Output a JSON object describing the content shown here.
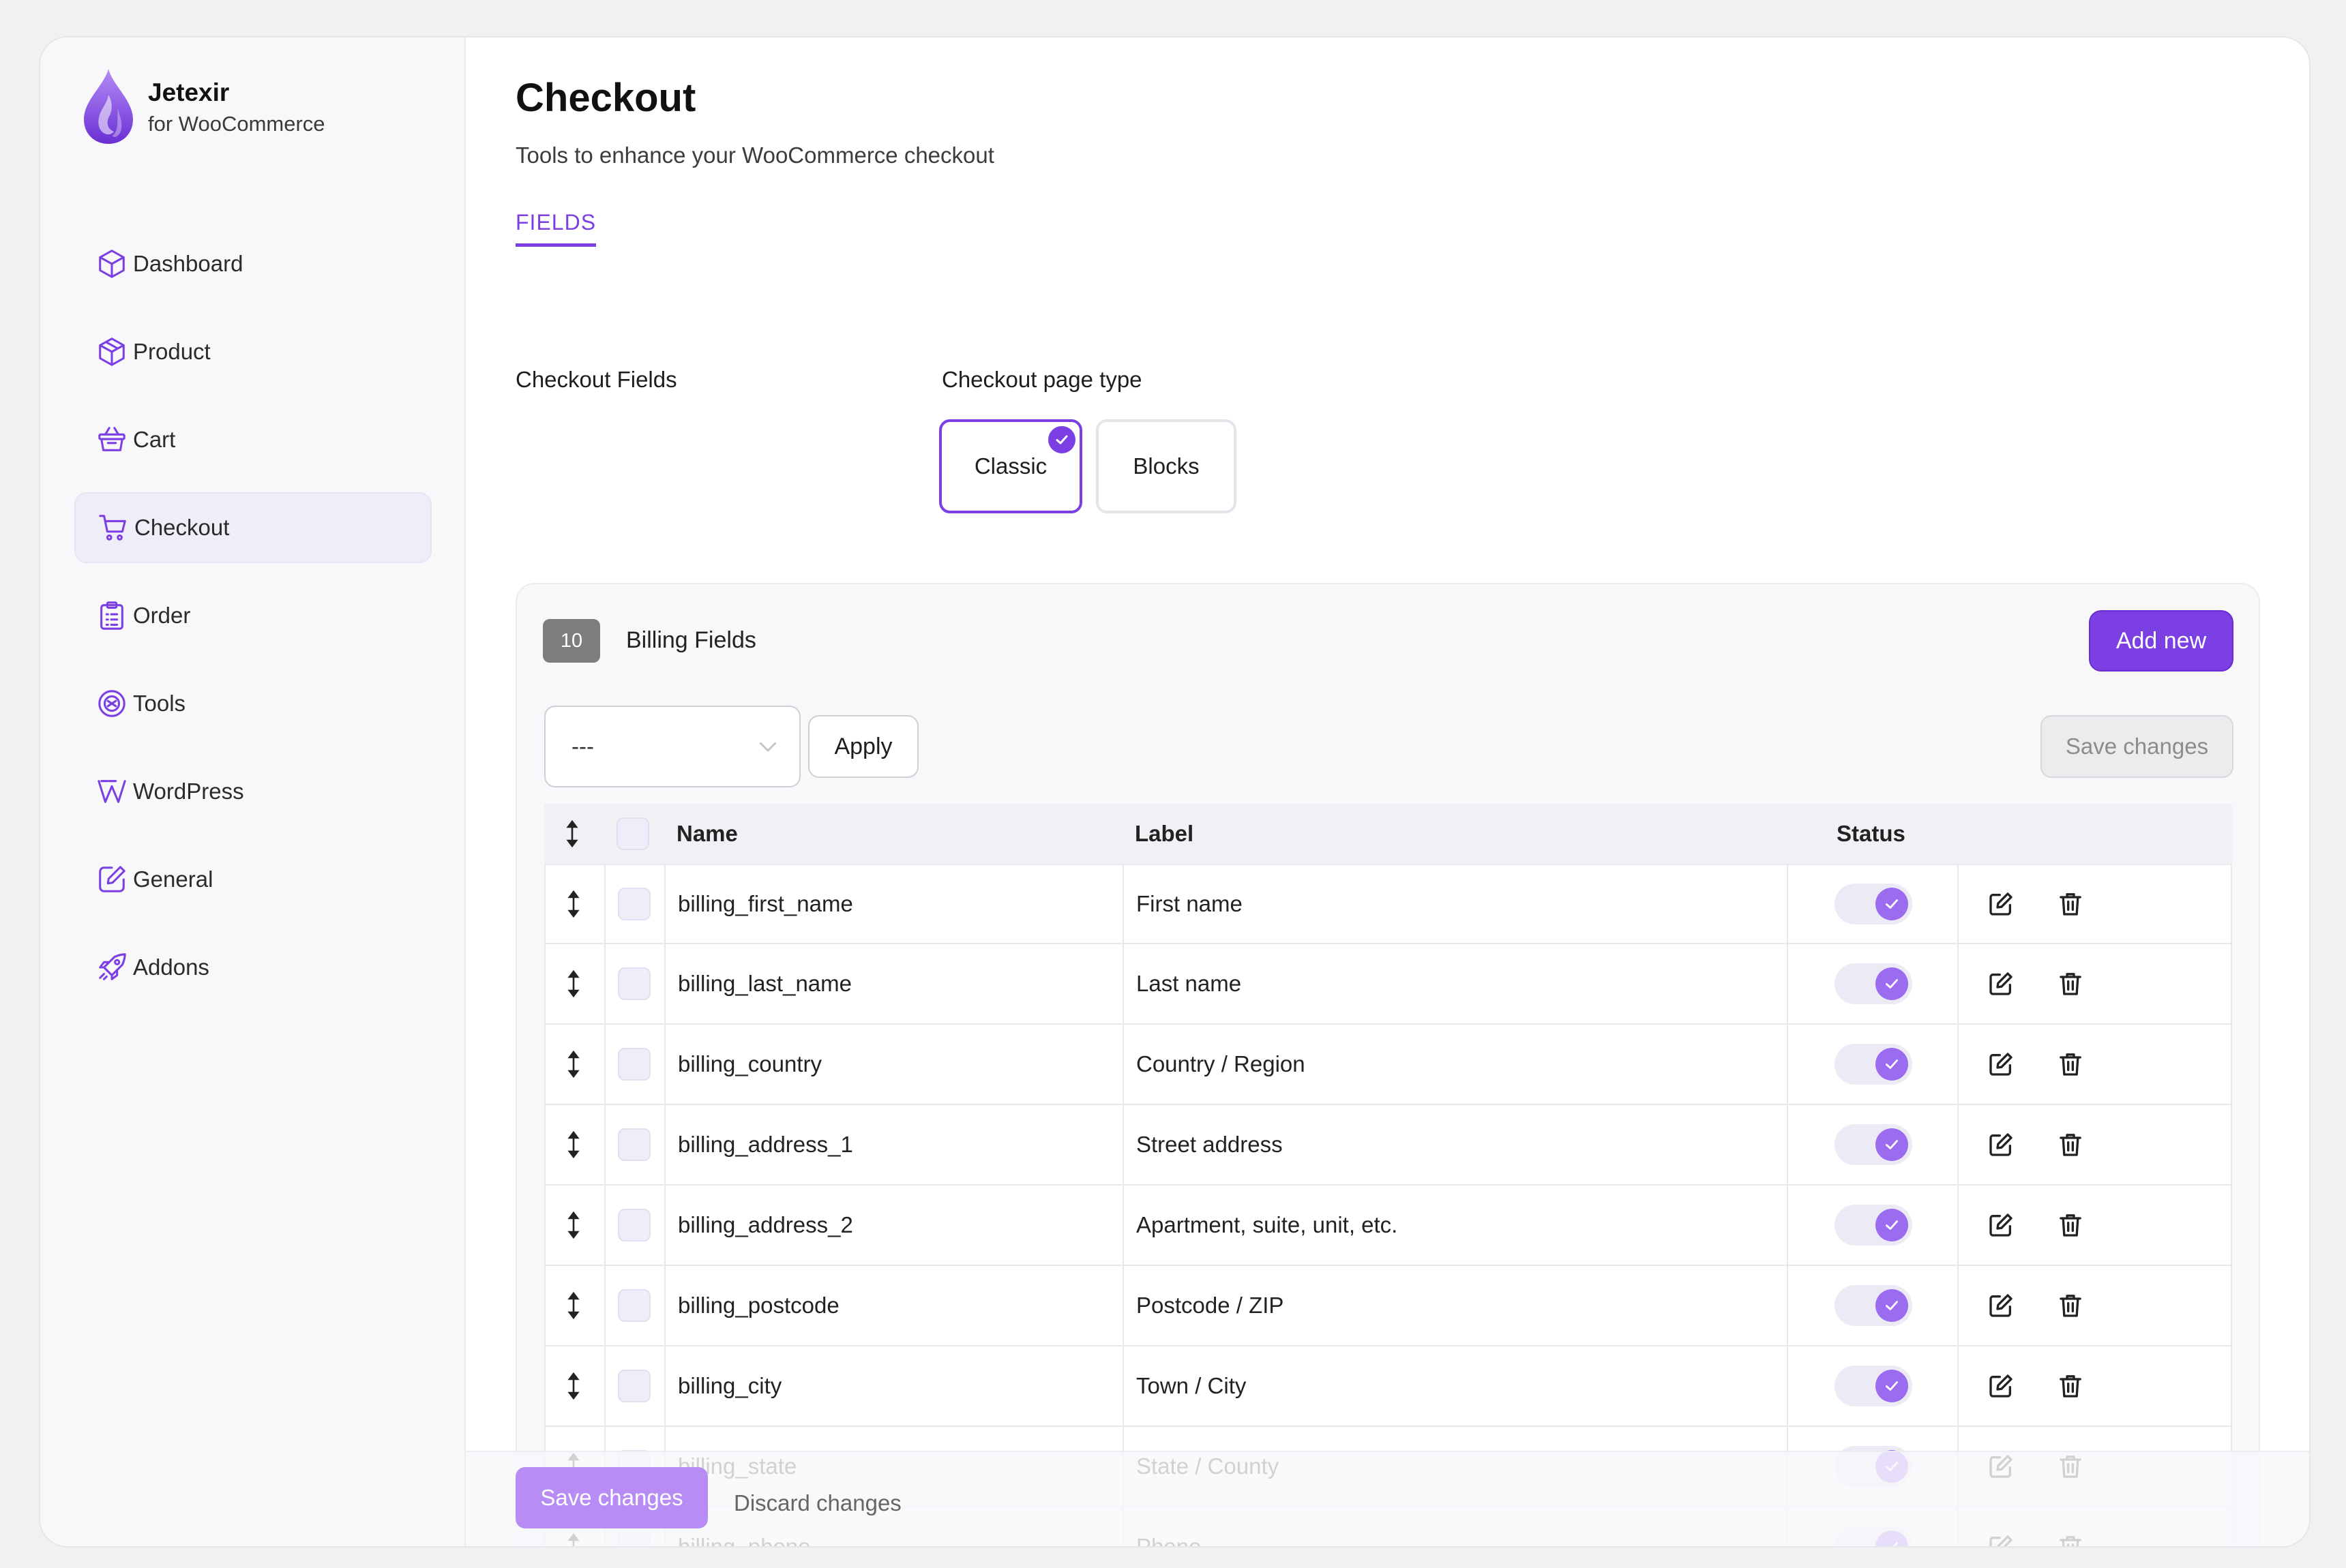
{
  "brand": {
    "name": "Jetexir",
    "subtitle": "for WooCommerce"
  },
  "sidebar": {
    "items": [
      {
        "label": "Dashboard",
        "icon": "cube-icon",
        "active": false
      },
      {
        "label": "Product",
        "icon": "package-icon",
        "active": false
      },
      {
        "label": "Cart",
        "icon": "basket-icon",
        "active": false
      },
      {
        "label": "Checkout",
        "icon": "cart-icon",
        "active": true
      },
      {
        "label": "Order",
        "icon": "clipboard-list-icon",
        "active": false
      },
      {
        "label": "Tools",
        "icon": "tools-badge-icon",
        "active": false
      },
      {
        "label": "WordPress",
        "icon": "wordpress-icon",
        "active": false
      },
      {
        "label": "General",
        "icon": "edit-square-icon",
        "active": false
      },
      {
        "label": "Addons",
        "icon": "rocket-icon",
        "active": false
      }
    ]
  },
  "page": {
    "title": "Checkout",
    "subtitle": "Tools to enhance your WooCommerce checkout",
    "tab": "FIELDS",
    "fields_label": "Checkout Fields",
    "page_type_label": "Checkout page type",
    "page_types": [
      "Classic",
      "Blocks"
    ],
    "selected_page_type": "Classic"
  },
  "billing": {
    "count": "10",
    "title": "Billing Fields",
    "add_label": "Add new",
    "bulk_select_value": "---",
    "apply_label": "Apply",
    "save_label": "Save changes",
    "columns": {
      "name": "Name",
      "label": "Label",
      "status": "Status"
    },
    "rows": [
      {
        "name": "billing_first_name",
        "label": "First name",
        "enabled": true
      },
      {
        "name": "billing_last_name",
        "label": "Last name",
        "enabled": true
      },
      {
        "name": "billing_country",
        "label": "Country / Region",
        "enabled": true
      },
      {
        "name": "billing_address_1",
        "label": "Street address",
        "enabled": true
      },
      {
        "name": "billing_address_2",
        "label": "Apartment, suite, unit, etc.",
        "enabled": true
      },
      {
        "name": "billing_postcode",
        "label": "Postcode / ZIP",
        "enabled": true
      },
      {
        "name": "billing_city",
        "label": "Town / City",
        "enabled": true
      },
      {
        "name": "billing_state",
        "label": "State / County",
        "enabled": true
      },
      {
        "name": "billing_phone",
        "label": "Phone",
        "enabled": true
      }
    ]
  },
  "footer": {
    "save_label": "Save changes",
    "discard_label": "Discard changes"
  },
  "colors": {
    "accent": "#7b3fe4",
    "accent_light": "#b78df5",
    "toggle_knob": "#9b6cf0"
  }
}
